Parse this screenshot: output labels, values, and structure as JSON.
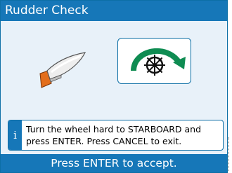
{
  "window": {
    "title": "Rudder Check"
  },
  "illustration": {
    "boat_icon": "boat-rudder-icon",
    "wheel_icon": "ship-wheel-starboard-icon",
    "colors": {
      "boat_hull": "#e9e9e9",
      "rudder": "#e36e1c",
      "arrow": "#0f8c52"
    }
  },
  "info": {
    "icon": "i",
    "line1": "Turn the wheel hard to STARBOARD and",
    "line2": "press ENTER. Press CANCEL to exit."
  },
  "footer": {
    "label": "Press ENTER to accept."
  },
  "theme": {
    "accent": "#1677b8",
    "background": "#e8f1f9",
    "border": "#0d6fa6"
  }
}
